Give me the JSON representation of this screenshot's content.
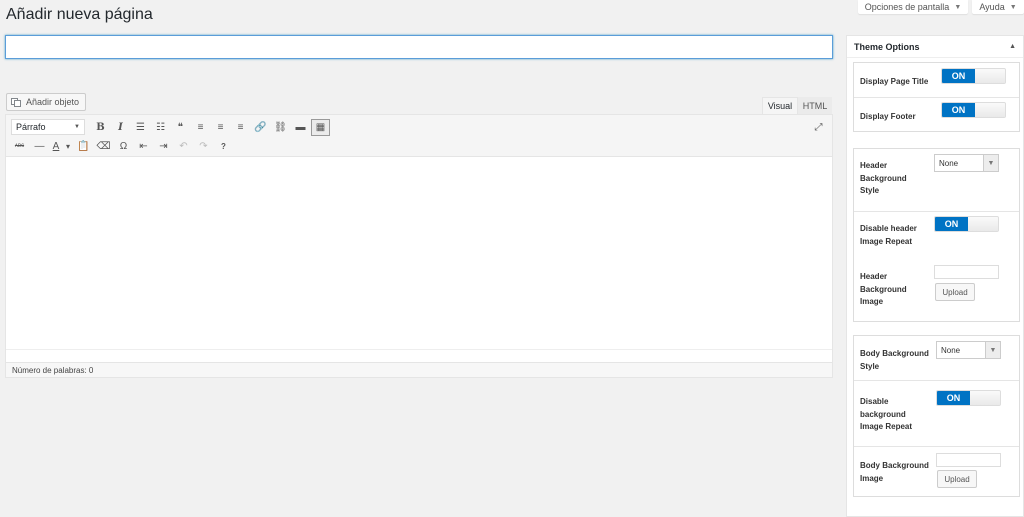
{
  "header": {
    "screen_options": "Opciones de pantalla",
    "help": "Ayuda",
    "page_title": "Añadir nueva página"
  },
  "title_field": {
    "value": "",
    "placeholder": ""
  },
  "media": {
    "add_media": "Añadir objeto"
  },
  "editor": {
    "tab_visual": "Visual",
    "tab_html": "HTML",
    "format_select": "Párrafo",
    "word_count": "Número de palabras: 0",
    "toolbar_row1": [
      {
        "name": "bold-icon",
        "glyph": "B",
        "cls": "bold"
      },
      {
        "name": "italic-icon",
        "glyph": "I",
        "cls": "ital"
      },
      {
        "name": "bullet-list-icon",
        "glyph": "☰",
        "cls": ""
      },
      {
        "name": "numbered-list-icon",
        "glyph": "☷",
        "cls": ""
      },
      {
        "name": "blockquote-icon",
        "glyph": "❝",
        "cls": ""
      },
      {
        "name": "align-left-icon",
        "glyph": "≡",
        "cls": ""
      },
      {
        "name": "align-center-icon",
        "glyph": "≡",
        "cls": ""
      },
      {
        "name": "align-right-icon",
        "glyph": "≡",
        "cls": ""
      },
      {
        "name": "link-icon",
        "glyph": "🔗",
        "cls": ""
      },
      {
        "name": "unlink-icon",
        "glyph": "⛓",
        "cls": ""
      },
      {
        "name": "read-more-icon",
        "glyph": "▬",
        "cls": ""
      },
      {
        "name": "toolbar-toggle-icon",
        "glyph": "▦",
        "cls": "active"
      }
    ],
    "toolbar_row2": [
      {
        "name": "strikethrough-icon",
        "glyph": "ᴀʙᴄ",
        "cls": ""
      },
      {
        "name": "horizontal-line-icon",
        "glyph": "—",
        "cls": ""
      },
      {
        "name": "text-color-icon",
        "glyph": "A",
        "cls": ""
      },
      {
        "name": "text-color-caret-icon",
        "glyph": "▾",
        "cls": ""
      },
      {
        "name": "paste-text-icon",
        "glyph": "📋",
        "cls": ""
      },
      {
        "name": "clear-formatting-icon",
        "glyph": "⌫",
        "cls": ""
      },
      {
        "name": "special-character-icon",
        "glyph": "Ω",
        "cls": ""
      },
      {
        "name": "outdent-icon",
        "glyph": "⇤",
        "cls": ""
      },
      {
        "name": "indent-icon",
        "glyph": "⇥",
        "cls": ""
      },
      {
        "name": "undo-icon",
        "glyph": "↶",
        "cls": ""
      },
      {
        "name": "redo-icon",
        "glyph": "↷",
        "cls": ""
      },
      {
        "name": "help-icon",
        "glyph": "?",
        "cls": ""
      }
    ]
  },
  "theme_options": {
    "title": "Theme Options",
    "display_page_title": "Display Page Title",
    "display_footer": "Display Footer",
    "header_background_style": "Header Background Style",
    "header_background_style_value": "None",
    "disable_header_image_repeat": "Disable header Image Repeat",
    "header_background_image": "Header Background Image",
    "body_background_style": "Body Background Style",
    "body_background_style_value": "None",
    "disable_background_image_repeat": "Disable background Image Repeat",
    "body_background_image": "Body Background Image",
    "toggle_on": "ON",
    "upload": "Upload"
  },
  "colors": {
    "accent": "#0073c4",
    "focus": "#5b9dd9"
  }
}
